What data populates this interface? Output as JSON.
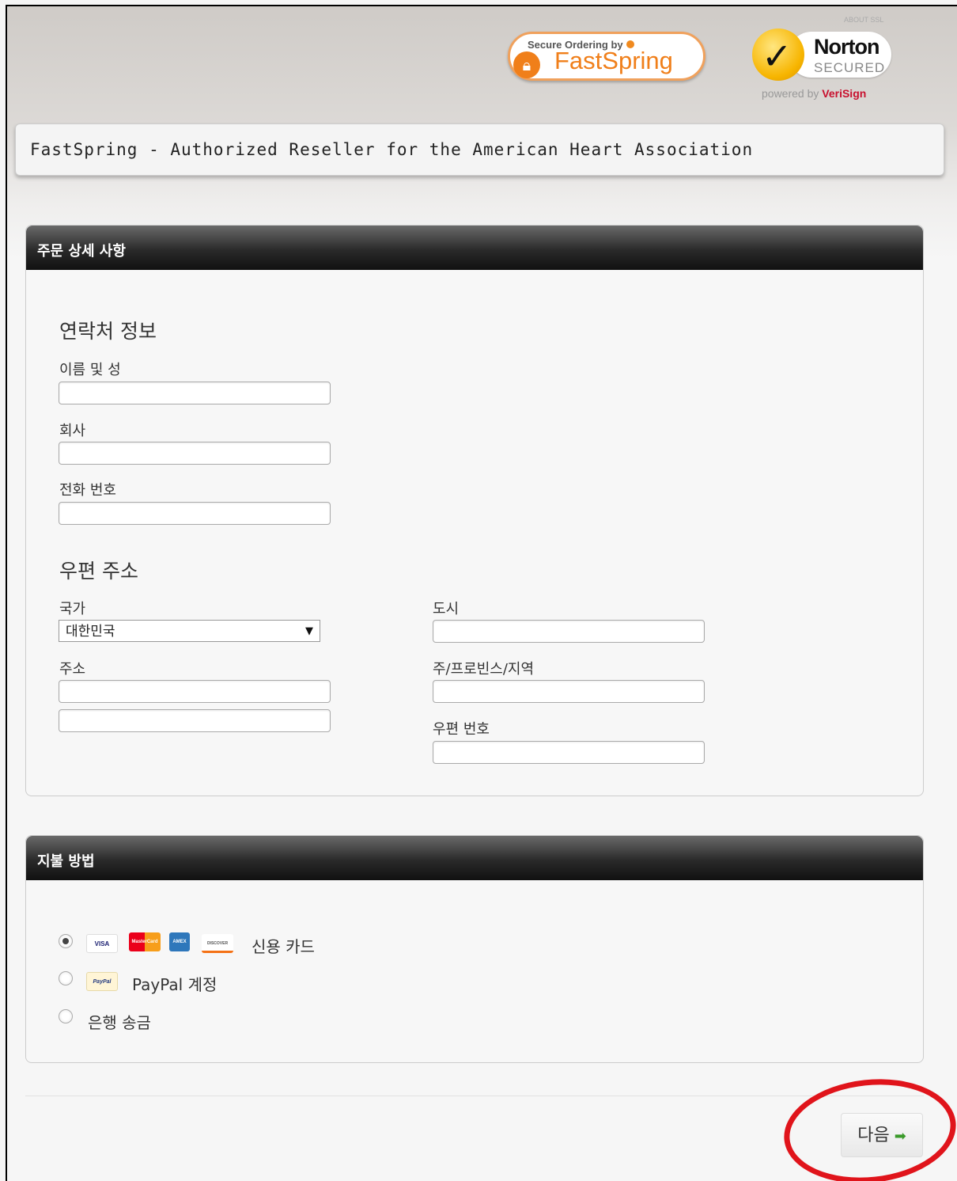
{
  "badges": {
    "fastspring_small": "Secure Ordering by",
    "fastspring_name": "FastSpring",
    "norton_tiny": "ABOUT SSL",
    "norton_word": "Norton",
    "norton_secured": "SECURED",
    "norton_powered_prefix": "powered by ",
    "norton_powered_brand": "VeriSign"
  },
  "header": {
    "title": "FastSpring - Authorized Reseller for the American Heart Association"
  },
  "order_panel": {
    "title": "주문 상세 사항",
    "contact_section": "연락처 정보",
    "name_label": "이름 및 성",
    "company_label": "회사",
    "phone_label": "전화 번호",
    "postal_section": "우편 주소",
    "country_label": "국가",
    "country_value": "대한민국",
    "address_label": "주소",
    "city_label": "도시",
    "state_label": "주/프로빈스/지역",
    "zip_label": "우편 번호"
  },
  "payment_panel": {
    "title": "지불 방법",
    "card_visa": "VISA",
    "card_mc": "MasterCard",
    "card_amex": "AMEX",
    "card_discover": "DISCOVER",
    "card_paypal": "PayPal",
    "credit_card_label": "신용 카드",
    "paypal_label": "PayPal 계정",
    "bank_label": "은행 송금",
    "selected": "credit_card"
  },
  "footer": {
    "next_label": "다음",
    "next_arrow": "➡"
  },
  "colors": {
    "fastspring_orange": "#f07f1a",
    "annotation_red": "#e0141b",
    "next_arrow_green": "#3a9a2a"
  }
}
